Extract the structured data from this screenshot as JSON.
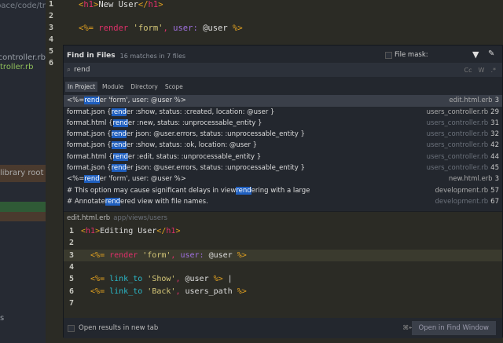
{
  "sidebar": {
    "path": "rkspace/code/tr",
    "items": [
      "n_controller.rb",
      "troller.rb",
      "library root",
      "s"
    ]
  },
  "editor": {
    "lines": [
      {
        "n": "1",
        "parts": [
          [
            "tag",
            "<"
          ],
          [
            "tn",
            "h1"
          ],
          [
            "tag",
            ">"
          ],
          [
            "",
            "New User"
          ],
          [
            "tag",
            "</"
          ],
          [
            "tn",
            "h1"
          ],
          [
            "tag",
            ">"
          ]
        ]
      },
      {
        "n": "2",
        "parts": []
      },
      {
        "n": "3",
        "parts": [
          [
            "tag",
            "<%= "
          ],
          [
            "kw",
            "render"
          ],
          [
            "str",
            " 'form'"
          ],
          [
            "kw",
            ", "
          ],
          [
            "sym",
            "user:"
          ],
          [
            "",
            " @user "
          ],
          [
            "tag",
            "%>"
          ]
        ]
      },
      {
        "n": "4",
        "parts": []
      },
      {
        "n": "5",
        "parts": []
      },
      {
        "n": "6",
        "parts": []
      }
    ]
  },
  "find": {
    "title": "Find in Files",
    "count": "16 matches in 7 files",
    "file_mask_label": "File mask:",
    "query": "rend",
    "toggles": [
      "Cc",
      "W",
      ".*"
    ],
    "scopes": [
      "In Project",
      "Module",
      "Directory",
      "Scope"
    ],
    "results": [
      {
        "pre": "<%= ",
        "hl": "rend",
        "post": "er 'form', user: @user %>",
        "file": "edit.html.erb",
        "line": "3",
        "dim": false
      },
      {
        "pre": "format.json { ",
        "hl": "rend",
        "post": "er :show, status: :created, location: @user }",
        "file": "users_controller.rb",
        "line": "29",
        "dim": false
      },
      {
        "pre": "format.html { ",
        "hl": "rend",
        "post": "er :new, status: :unprocessable_entity }",
        "file": "users_controller.rb",
        "line": "31",
        "dim": true
      },
      {
        "pre": "format.json { ",
        "hl": "rend",
        "post": "er json: @user.errors, status: :unprocessable_entity }",
        "file": "users_controller.rb",
        "line": "32",
        "dim": true
      },
      {
        "pre": "format.json { ",
        "hl": "rend",
        "post": "er :show, status: :ok, location: @user }",
        "file": "users_controller.rb",
        "line": "42",
        "dim": true
      },
      {
        "pre": "format.html { ",
        "hl": "rend",
        "post": "er :edit, status: :unprocessable_entity }",
        "file": "users_controller.rb",
        "line": "44",
        "dim": true
      },
      {
        "pre": "format.json { ",
        "hl": "rend",
        "post": "er json: @user.errors, status: :unprocessable_entity }",
        "file": "users_controller.rb",
        "line": "45",
        "dim": true
      },
      {
        "pre": "<%= ",
        "hl": "rend",
        "post": "er 'form', user: @user %>",
        "file": "new.html.erb",
        "line": "3",
        "dim": false
      },
      {
        "pre": "# This option may cause significant delays in view ",
        "hl": "rend",
        "post": "ering with a large",
        "file": "development.rb",
        "line": "57",
        "dim": false
      },
      {
        "pre": "# Annotate ",
        "hl": "rend",
        "post": "ered view with file names.",
        "file": "development.rb",
        "line": "67",
        "dim": true
      }
    ],
    "preview_file": "edit.html.erb",
    "preview_path": "app/views/users",
    "preview": [
      {
        "n": "1",
        "parts": [
          [
            "tag",
            "<"
          ],
          [
            "tn",
            "h1"
          ],
          [
            "tag",
            ">"
          ],
          [
            "",
            "Editing User"
          ],
          [
            "tag",
            "</"
          ],
          [
            "tn",
            "h1"
          ],
          [
            "tag",
            ">"
          ]
        ]
      },
      {
        "n": "2",
        "parts": []
      },
      {
        "n": "3",
        "parts": [
          [
            "tag",
            "  <%= "
          ],
          [
            "kw",
            "render"
          ],
          [
            "str",
            " 'form'"
          ],
          [
            "kw",
            ", "
          ],
          [
            "sym",
            "user:"
          ],
          [
            "",
            " @user "
          ],
          [
            "tag",
            "%>"
          ]
        ]
      },
      {
        "n": "4",
        "parts": []
      },
      {
        "n": "5",
        "parts": [
          [
            "tag",
            "  <%= "
          ],
          [
            "fn",
            "link_to"
          ],
          [
            "str",
            " 'Show'"
          ],
          [
            "kw",
            ", "
          ],
          [
            "",
            "@user "
          ],
          [
            "tag",
            "%>"
          ],
          [
            "",
            " |"
          ]
        ]
      },
      {
        "n": "6",
        "parts": [
          [
            "tag",
            "  <%= "
          ],
          [
            "fn",
            "link_to"
          ],
          [
            "str",
            " 'Back'"
          ],
          [
            "kw",
            ", "
          ],
          [
            "",
            "users_path "
          ],
          [
            "tag",
            "%>"
          ]
        ]
      },
      {
        "n": "7",
        "parts": []
      }
    ],
    "open_new_tab": "Open results in new tab",
    "shortcut": "⌘↵",
    "open_window": "Open in Find Window"
  }
}
